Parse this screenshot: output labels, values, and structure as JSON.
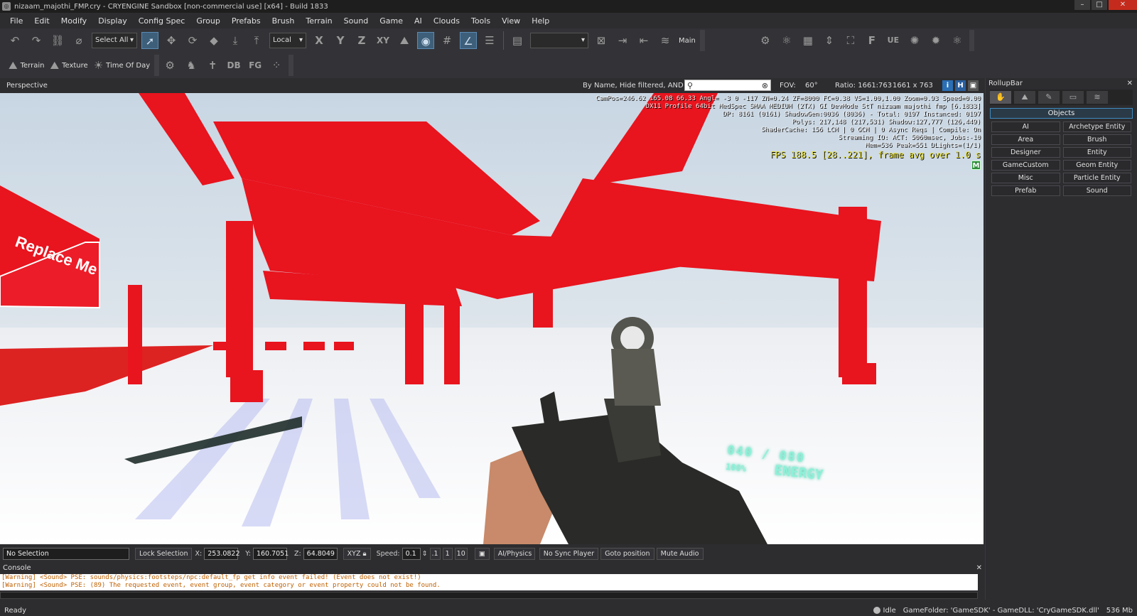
{
  "window": {
    "title": "nizaam_majothi_FMP.cry - CRYENGINE Sandbox [non-commercial use] [x64] - Build 1833"
  },
  "menu": [
    "File",
    "Edit",
    "Modify",
    "Display",
    "Config Spec",
    "Group",
    "Prefabs",
    "Brush",
    "Terrain",
    "Sound",
    "Game",
    "AI",
    "Clouds",
    "Tools",
    "View",
    "Help"
  ],
  "toolbar": {
    "select_all": "Select All",
    "coord_system": "Local",
    "axes": [
      "X",
      "Y",
      "Z",
      "XY"
    ],
    "layer": "Main",
    "terrain": "Terrain",
    "texture": "Texture",
    "time_of_day": "Time Of Day",
    "db": "DB",
    "fg": "FG"
  },
  "viewport_bar": {
    "view_name": "Perspective",
    "filter": "By Name, Hide filtered, AND",
    "search_value": "",
    "fov_label": "FOV:",
    "fov_value": "60°",
    "ratio_label": "Ratio:",
    "ratio_value": "1661:763",
    "resolution": "1661 x 763",
    "info_btn": "i",
    "h_btn": "H"
  },
  "viewport": {
    "stats_lines": [
      "CamPos=246.62 165.08 66.33 Angl= -3  0 -117 ZN=0.24 ZF=8000 FC=0.38 VS=1.00,1.00 Zoom=0.93 Speed=0.00",
      "DX11 Profile 64bit MedSpec SMAA MEDIUM (2TX) GI DevMode StT nizaam majothi fmp [6.1833]",
      "DP: 8161 (0161) ShadowGen:0036 (8036) - Total: 0197 Instanced: 0197",
      "Polys: 217,148 (217,531) Shadow:127,777 (126,449)",
      "ShaderCache: 156 LCM | 0 GCM | 0 Async Reqs | Compile: On",
      "Streaming IO: ACT: 5060msec, Jobs:-10",
      "Mem=536 Peak=551 DLights=(1/1)"
    ],
    "fps": "FPS 188.5 [28..221], frame avg over 1.0 s",
    "badge": "M",
    "hud_energy": "ENERGY",
    "hud_numbers": "040 / 080",
    "hud_percent": "100%",
    "sign_text": "Replace Me"
  },
  "rollup": {
    "title": "RollupBar",
    "objects_header": "Objects",
    "items": [
      "AI",
      "Archetype Entity",
      "Area",
      "Brush",
      "Designer",
      "Entity",
      "GameCustom",
      "Geom Entity",
      "Misc",
      "Particle Entity",
      "Prefab",
      "Sound"
    ]
  },
  "statusbar": {
    "selection": "No Selection",
    "lock_selection": "Lock Selection",
    "x_label": "X:",
    "x_value": "253.0822",
    "y_label": "Y:",
    "y_value": "160.7051",
    "z_label": "Z:",
    "z_value": "64.8049",
    "xyz": "XYZ",
    "speed_label": "Speed:",
    "speed_value": "0.1",
    "speed_presets": [
      ".1",
      "1",
      "10"
    ],
    "ai_physics": "AI/Physics",
    "no_sync": "No Sync Player",
    "goto": "Goto position",
    "mute": "Mute Audio"
  },
  "console": {
    "title": "Console",
    "lines": [
      "[Warning] <Sound> PSE: sounds/physics:footsteps/npc:default_fp get info event failed! (Event does not exist!)",
      "[Warning] <Sound> PSE: (89) The requested event, event group, event category or event property could not be found."
    ]
  },
  "bottombar": {
    "status": "Ready",
    "state": "Idle",
    "game_folder": "GameFolder: 'GameSDK' - GameDLL: 'CryGameSDK.dll'",
    "memory": "536 Mb"
  }
}
